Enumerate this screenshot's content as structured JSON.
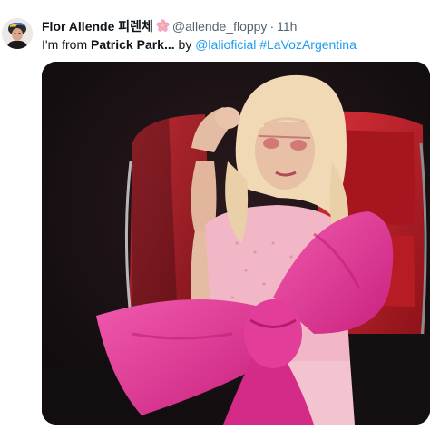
{
  "tweet": {
    "author": {
      "display_name": "Flor Allende 피렌체",
      "emoji_icon": "cherry-blossom-icon",
      "handle": "@allende_floppy",
      "separator": "·",
      "timestamp": "11h"
    },
    "text": {
      "intro": "I'm from ",
      "bold": "Patrick Park...",
      "by": " by ",
      "mention": "@lalioficial",
      "hashtag": "#LaVozArgentina"
    },
    "media": {
      "kind": "video-still",
      "colors": {
        "background": "#0f0c0e",
        "chair_red": "#c0222a",
        "bow_pink": "#e7369b",
        "dress_pink": "#f2b7c6",
        "hair_blonde": "#f1d9b5",
        "skin": "#e7c0a6"
      }
    },
    "colors": {
      "link": "#1d9bf0",
      "secondary_text": "#536471",
      "primary_text": "#0f1419"
    }
  }
}
